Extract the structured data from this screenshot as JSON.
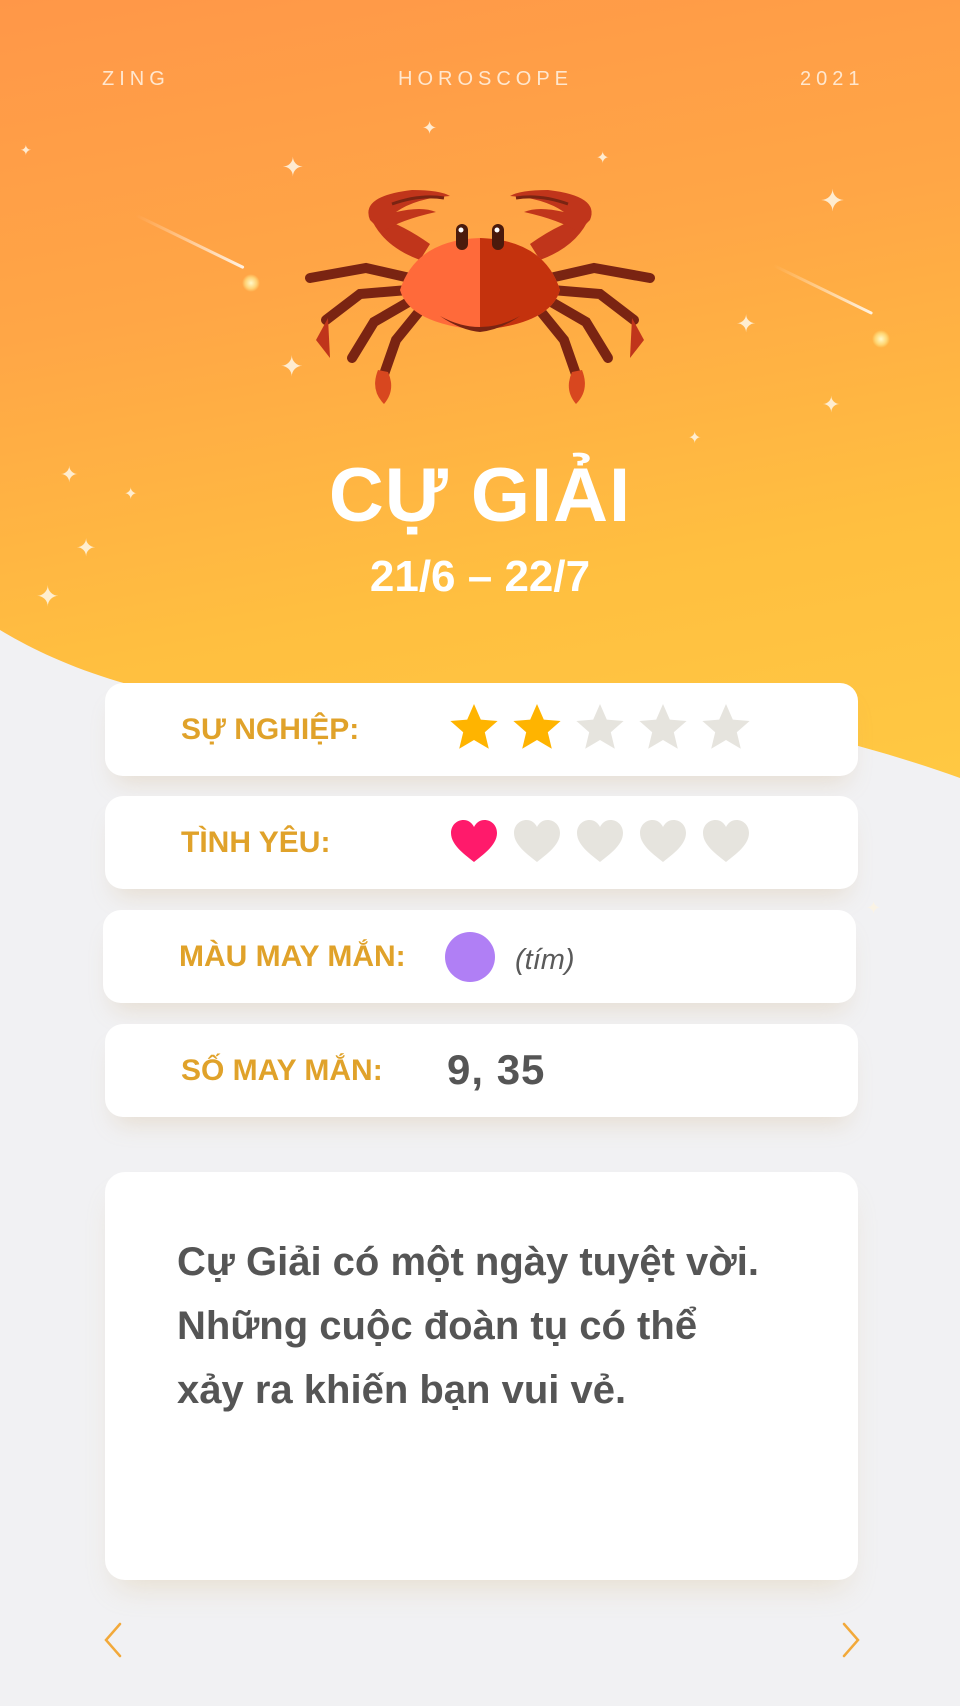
{
  "header": {
    "brand": "ZING",
    "section": "HOROSCOPE",
    "year": "2021"
  },
  "sign": {
    "icon": "crab-icon",
    "name": "CỰ GIẢI",
    "dates": "21/6 – 22/7"
  },
  "stats": {
    "career": {
      "label": "SỰ NGHIỆP:",
      "rating": 2,
      "max": 5,
      "icon": "star-icon"
    },
    "love": {
      "label": "TÌNH YÊU:",
      "rating": 1,
      "max": 5,
      "icon": "heart-icon"
    },
    "lucky_color": {
      "label": "MÀU MAY MẮN:",
      "color_hex": "#b07ff5",
      "color_name": "(tím)"
    },
    "lucky_number": {
      "label": "SỐ MAY MẮN:",
      "value": "9, 35"
    }
  },
  "description": {
    "line1": "Cự Giải có một ngày tuyệt vời.",
    "line2": "Những cuộc đoàn tụ có thể",
    "line3": "xảy ra khiến bạn vui vẻ."
  },
  "navigation": {
    "prev_icon": "chevron-left-icon",
    "next_icon": "chevron-right-icon"
  },
  "colors": {
    "accent_label": "#e0a22a",
    "star_active": "#ffb400",
    "heart_active": "#ff1a6b",
    "inactive": "#e6e4de",
    "hero_top": "#ff9748",
    "hero_bottom": "#ffc943"
  }
}
